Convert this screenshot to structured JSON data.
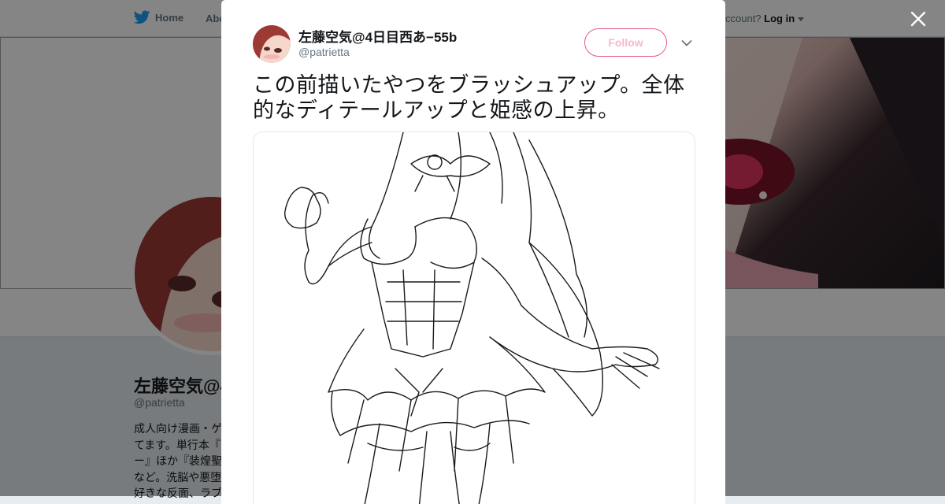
{
  "nav": {
    "home_label": "Home",
    "about_label": "Abo",
    "account_prompt": "ccount?",
    "login_label": "Log in"
  },
  "background_profile": {
    "display_name": "左藤空気@4",
    "handle": "@patrietta",
    "bio_lines": [
      "成人向け漫画・ゲ",
      "てます。単行本『",
      "ー』ほか『装煌聖",
      "など。洗脳や悪堕",
      "好きな反面、ラブ"
    ]
  },
  "tweet": {
    "author_name": "左藤空気@4日目西あ−55b",
    "author_handle": "@patrietta",
    "follow_label": "Follow",
    "text": "この前描いたやつをブラッシュアップ。全体的なディテールアップと姫感の上昇。"
  },
  "icons": {
    "bird": "twitter-bird-icon",
    "close": "close-icon",
    "caret": "chevron-down-icon"
  },
  "colors": {
    "brand_blue": "#1da1f2",
    "follow_pink": "#e0245e",
    "text_primary": "#14171a",
    "text_secondary": "#657786"
  }
}
